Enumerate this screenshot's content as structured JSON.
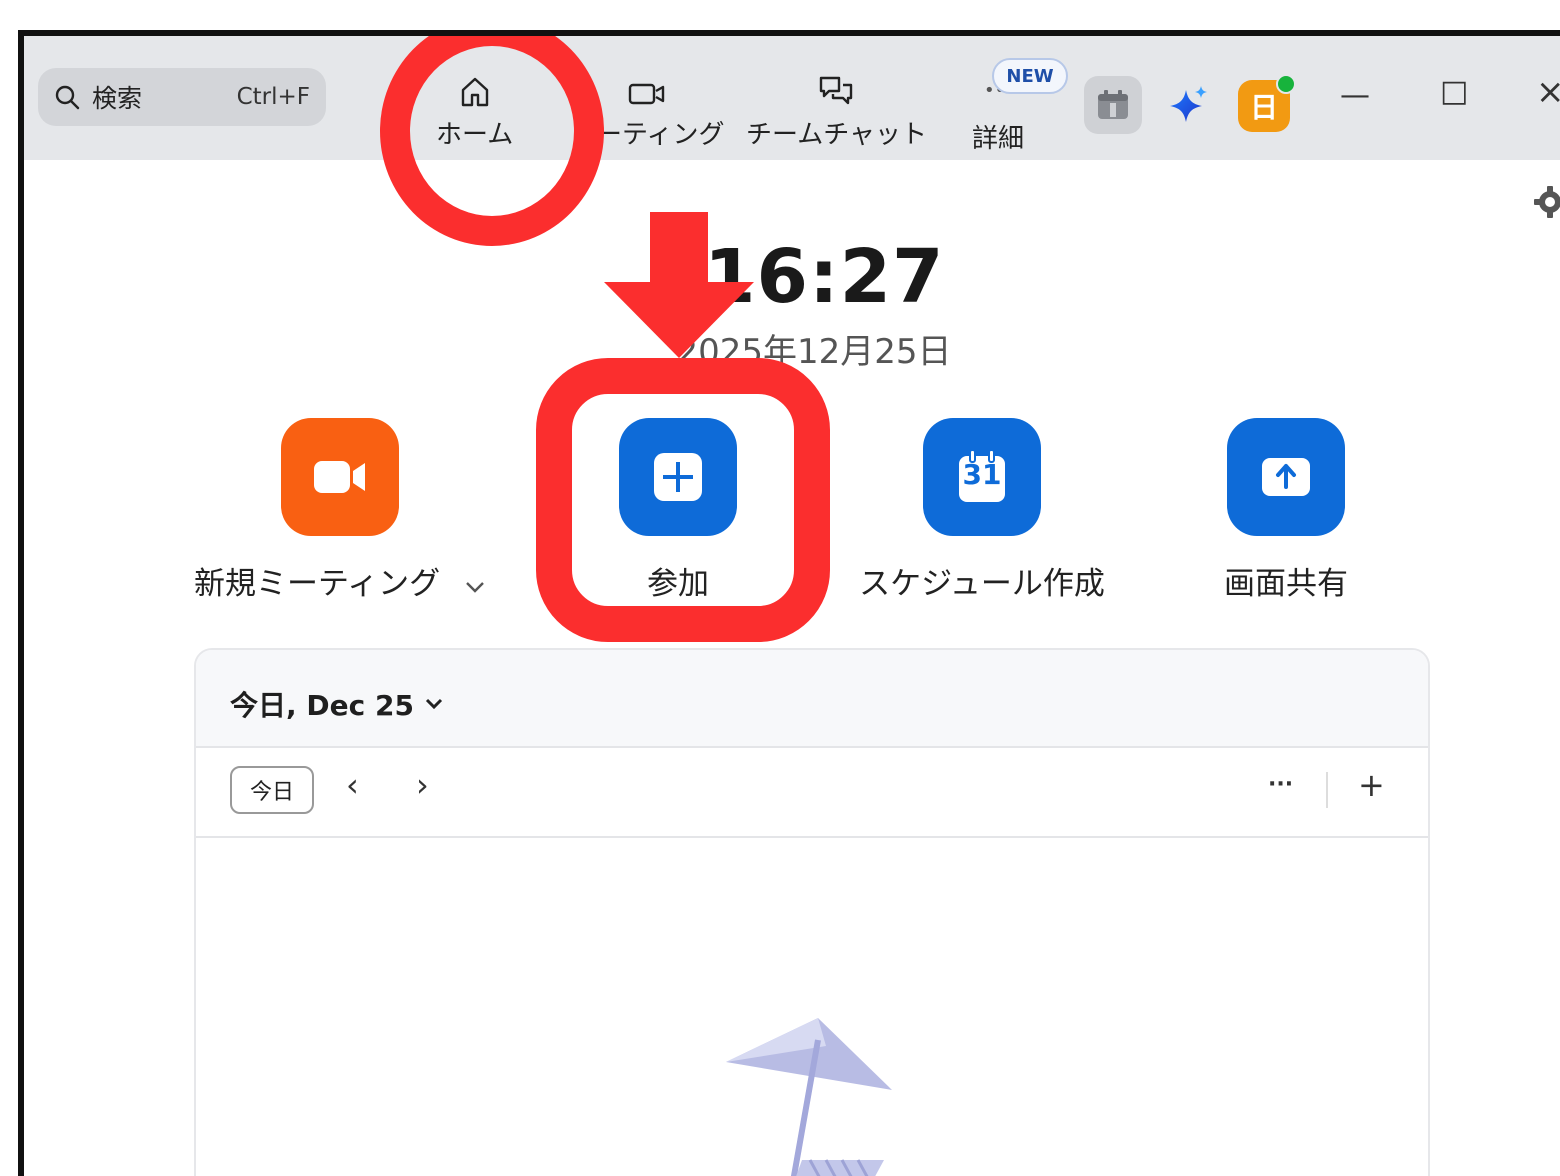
{
  "search": {
    "label": "検索",
    "shortcut": "Ctrl+F"
  },
  "nav": {
    "home": "ホーム",
    "meetings": "ミーティング",
    "team_chat": "チームチャット",
    "more": "詳細",
    "new_badge": "NEW"
  },
  "avatar_letter": "日",
  "window": {
    "minimize": "—",
    "maximize": "□",
    "close": "×"
  },
  "clock": {
    "time": "16:27",
    "date": "2025年12月25日"
  },
  "actions": {
    "new_meeting": "新規ミーティング",
    "join": "参加",
    "schedule": "スケジュール作成",
    "share_screen": "画面共有",
    "calendar_day": "31"
  },
  "calendar_panel": {
    "title": "今日, Dec 25",
    "today_button": "今日",
    "prev": "‹",
    "next": "›",
    "more": "···",
    "add": "+"
  },
  "colors": {
    "accent_blue": "#0e6bd8",
    "new_meeting_orange": "#f96012",
    "annotation_red": "#fb2e2e",
    "avatar_orange": "#f29a12",
    "presence_green": "#17b33c"
  },
  "icons": [
    "search-icon",
    "home-icon",
    "video-camera-icon",
    "chat-bubbles-icon",
    "calendar-app-icon",
    "ai-sparkle-icon",
    "gear-icon",
    "plus-icon",
    "calendar-icon",
    "share-up-arrow-icon",
    "chevron-down-icon",
    "beach-umbrella-illustration"
  ]
}
